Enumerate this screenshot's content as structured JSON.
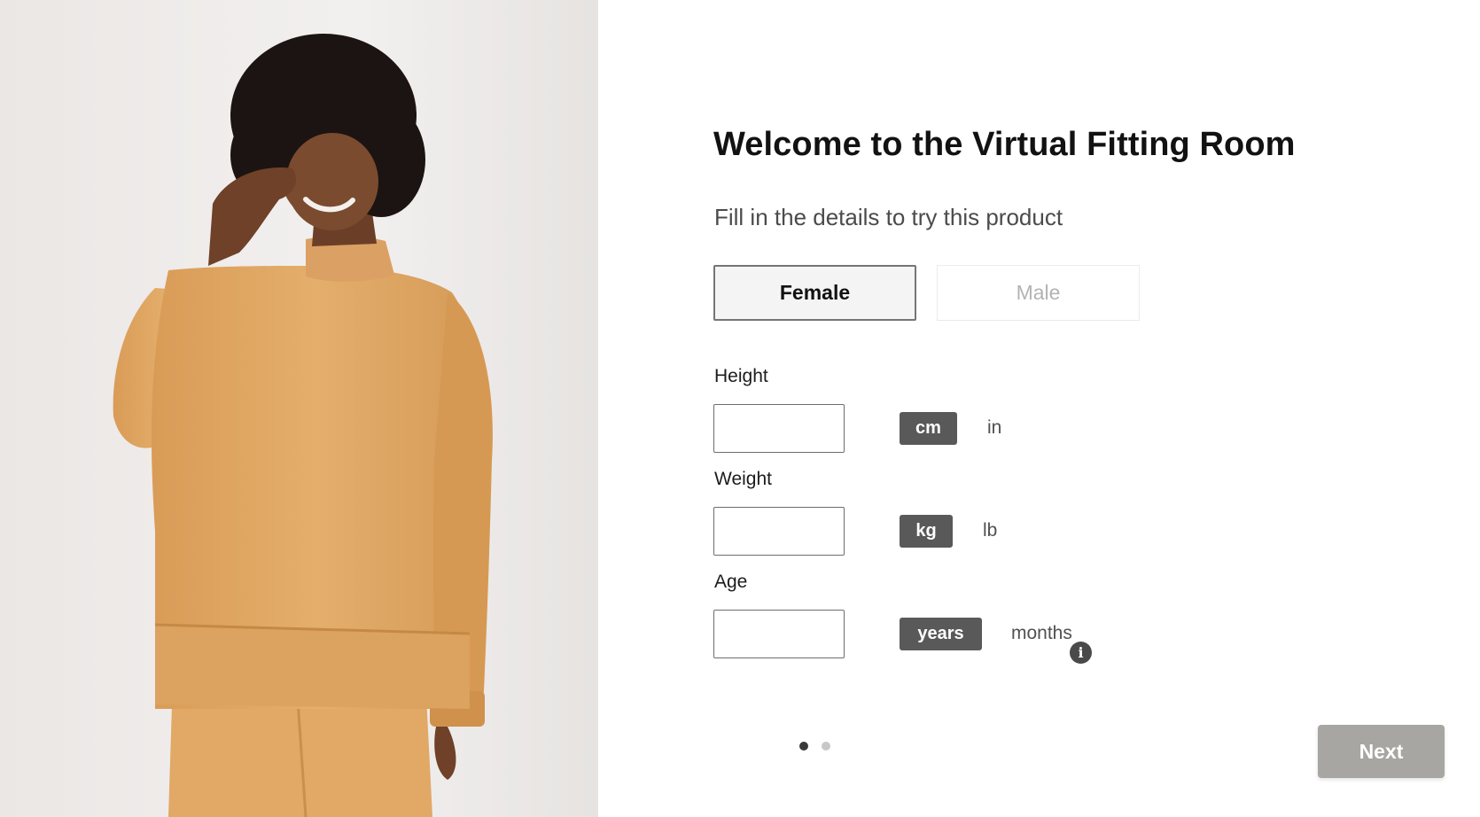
{
  "hero": {
    "icon": "model-photo"
  },
  "form": {
    "title": "Welcome to the Virtual Fitting Room",
    "subtitle": "Fill in the details to try this product",
    "gender": {
      "female_label": "Female",
      "male_label": "Male",
      "selected": "Female"
    },
    "height": {
      "label": "Height",
      "value": "",
      "unit_active": "cm",
      "unit_inactive": "in"
    },
    "weight": {
      "label": "Weight",
      "value": "",
      "unit_active": "kg",
      "unit_inactive": "lb"
    },
    "age": {
      "label": "Age",
      "value": "",
      "unit_active": "years",
      "unit_inactive": "months",
      "info_icon": "i"
    },
    "pagination": {
      "current": 1,
      "total": 2
    },
    "next_label": "Next"
  },
  "colors": {
    "unit_active_bg": "#595959",
    "next_bg": "#a7a6a2",
    "sweater": "#e2ad69",
    "selected_border": "#757575"
  }
}
